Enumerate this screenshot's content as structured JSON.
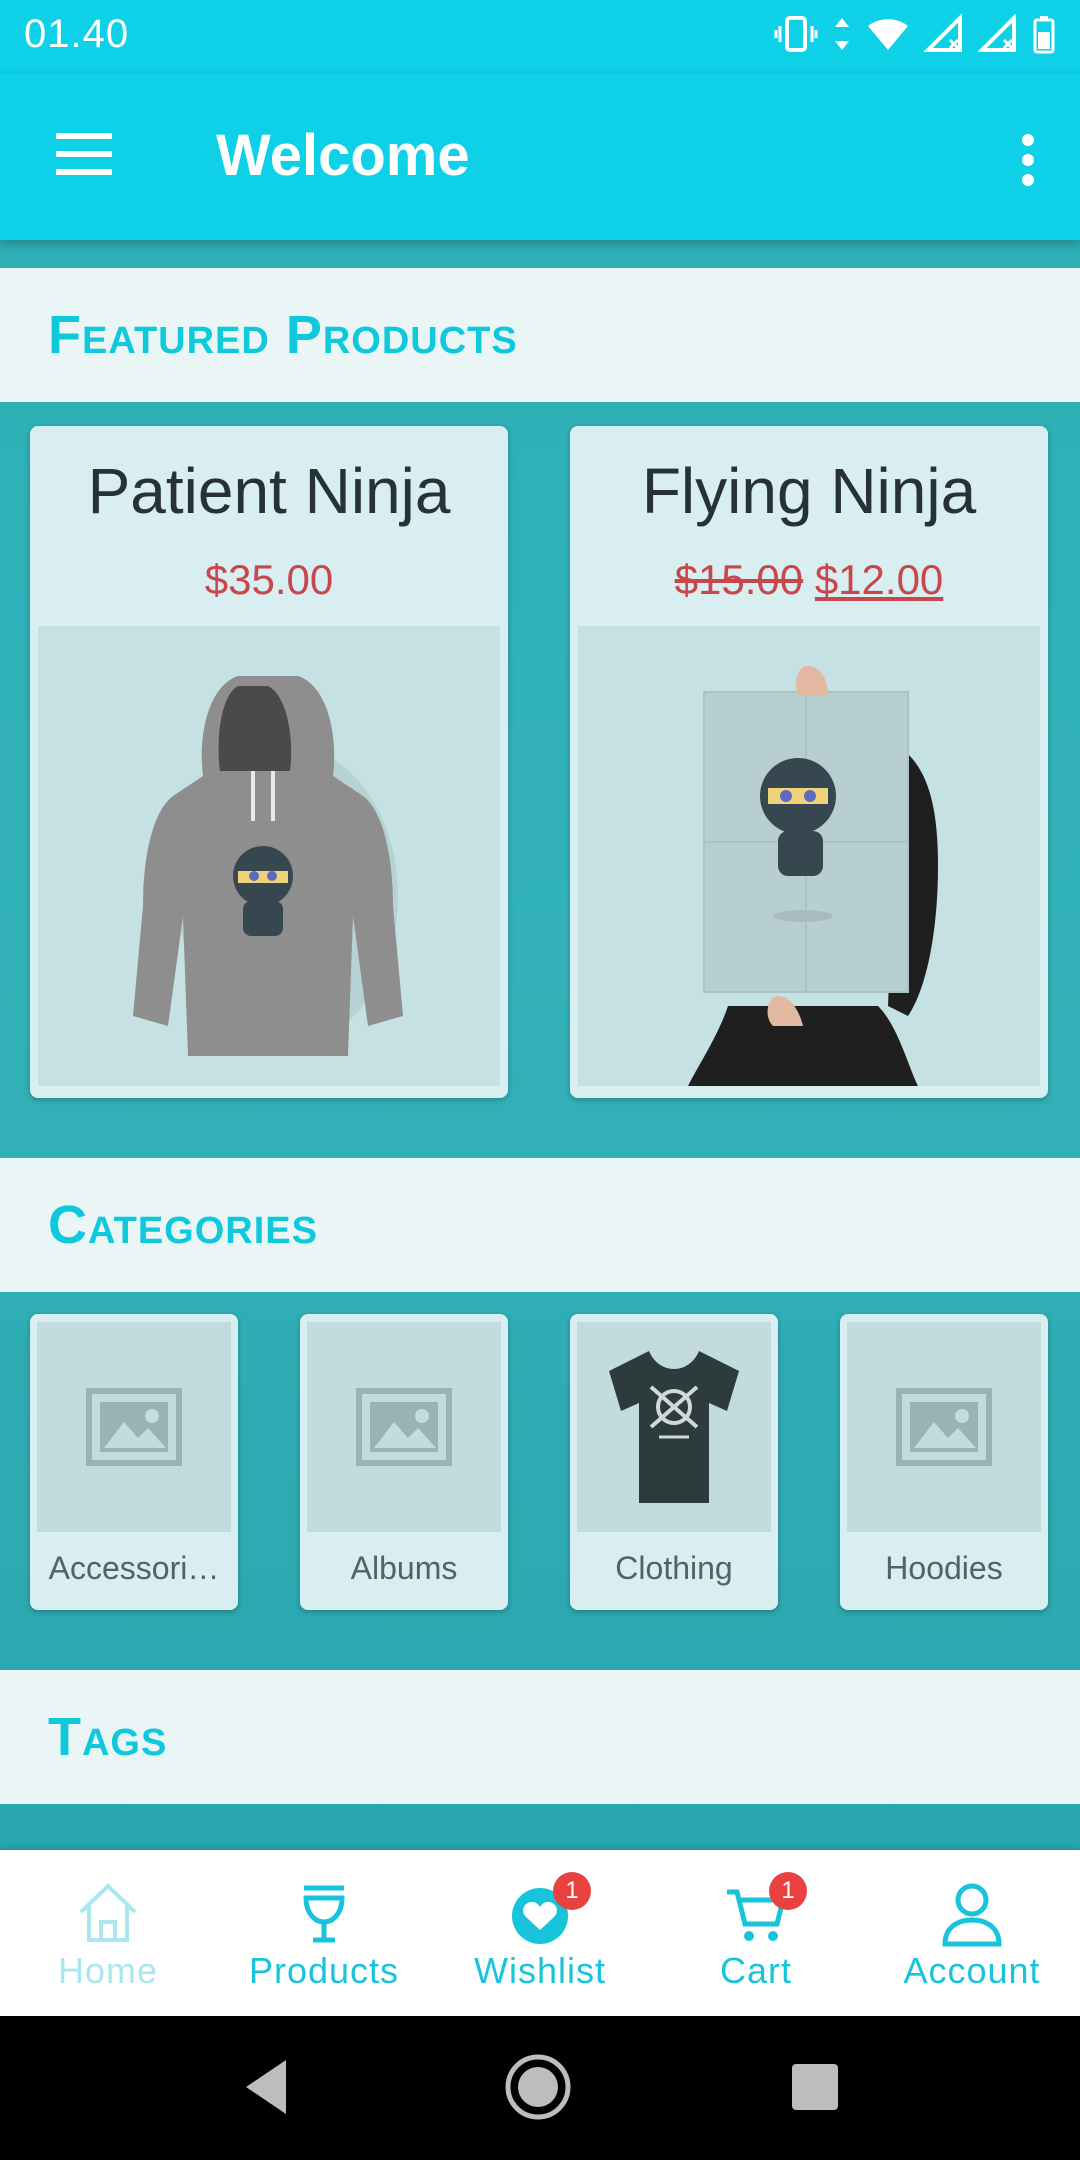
{
  "status_bar": {
    "time": "01.40"
  },
  "app_bar": {
    "title": "Welcome"
  },
  "sections": {
    "featured": "Featured Products",
    "categories": "Categories",
    "tags": "Tags"
  },
  "products": [
    {
      "name": "Patient Ninja",
      "price": "$35.00"
    },
    {
      "name": "Flying Ninja",
      "old_price": "$15.00",
      "price": "$12.00"
    }
  ],
  "categories": [
    {
      "label": "Accessori…",
      "icon": "image-placeholder-icon"
    },
    {
      "label": "Albums",
      "icon": "image-placeholder-icon"
    },
    {
      "label": "Clothing",
      "icon": "tshirt-image"
    },
    {
      "label": "Hoodies",
      "icon": "image-placeholder-icon"
    }
  ],
  "bottom_nav": {
    "items": [
      {
        "label": "Home",
        "icon": "home-icon",
        "active": true
      },
      {
        "label": "Products",
        "icon": "glass-icon"
      },
      {
        "label": "Wishlist",
        "icon": "heart-icon",
        "badge": "1"
      },
      {
        "label": "Cart",
        "icon": "cart-icon",
        "badge": "1"
      },
      {
        "label": "Account",
        "icon": "person-icon"
      }
    ]
  },
  "colors": {
    "accent": "#0ed1e8",
    "price": "#c8474c",
    "badge": "#e94040",
    "nav_label": "#17c4dc"
  }
}
